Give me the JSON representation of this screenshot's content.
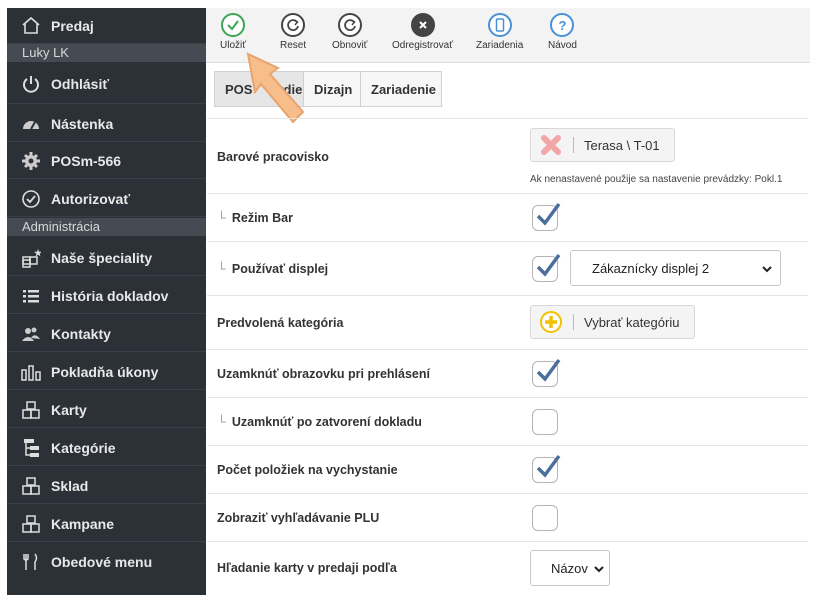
{
  "sidebar": {
    "top": {
      "label": "Predaj",
      "icon": "home-icon"
    },
    "user_section": "Luky LK",
    "items_a": [
      {
        "label": "Odhlásiť",
        "icon": "power-icon"
      },
      {
        "label": "Nástenka",
        "icon": "dashboard-icon"
      },
      {
        "label": "POSm-566",
        "icon": "gear-icon"
      },
      {
        "label": "Autorizovať",
        "icon": "check-circle-icon"
      }
    ],
    "admin_section": "Administrácia",
    "items_b": [
      {
        "label": "Naše špeciality",
        "icon": "specials-icon"
      },
      {
        "label": "História dokladov",
        "icon": "list-icon"
      },
      {
        "label": "Kontakty",
        "icon": "users-icon"
      },
      {
        "label": "Pokladňa úkony",
        "icon": "bars-icon"
      },
      {
        "label": "Karty",
        "icon": "cards-icon"
      },
      {
        "label": "Kategórie",
        "icon": "tree-icon"
      },
      {
        "label": "Sklad",
        "icon": "cards-icon"
      },
      {
        "label": "Kampane",
        "icon": "cards-icon"
      },
      {
        "label": "Obedové menu",
        "icon": "cutlery-icon"
      }
    ]
  },
  "toolbar": {
    "save": "Uložiť",
    "reset": "Reset",
    "renew": "Obnoviť",
    "unregister": "Odregistrovať",
    "devices": "Zariadenia",
    "guide": "Návod"
  },
  "tabs": [
    "POS",
    "Dizajn",
    "Zariadenie"
  ],
  "tab_hidden_text": "rdie",
  "settings": {
    "bar_workstation": {
      "label": "Barové pracovisko",
      "value": "Terasa \\ T-01",
      "note": "Ak nenastavené použije sa nastavenie prevádzky: Pokl.1"
    },
    "bar_mode": {
      "label": "Režim Bar",
      "checked": true
    },
    "use_display": {
      "label": "Používať displej",
      "checked": true,
      "select": "Zákaznícky displej 2"
    },
    "default_category": {
      "label": "Predvolená kategória",
      "button": "Vybrať kategóriu"
    },
    "lock_on_login": {
      "label": "Uzamknúť obrazovku pri prehlásení",
      "checked": true
    },
    "lock_on_close": {
      "label": "Uzamknúť po zatvorení dokladu",
      "checked": false
    },
    "item_count_issue": {
      "label": "Počet položiek na vychystanie",
      "checked": true
    },
    "show_plu_search": {
      "label": "Zobraziť vyhľadávanie PLU",
      "checked": false
    },
    "card_search_by": {
      "label": "Hľadanie karty v predaji podľa",
      "select": "Názov"
    }
  },
  "colors": {
    "sidebar": "#2c3138",
    "save_green": "#3aa655",
    "info_blue": "#4a90d9",
    "check_blue": "#4b6f9a",
    "pointer": "#f5b37a"
  }
}
